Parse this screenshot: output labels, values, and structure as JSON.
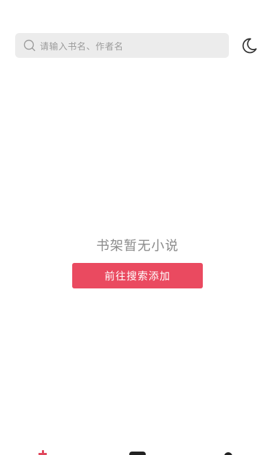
{
  "search": {
    "placeholder": "请输入书名、作者名"
  },
  "header": {
    "theme_toggle_icon": "moon-icon"
  },
  "empty_state": {
    "message": "书架暂无小说",
    "action_label": "前往搜索添加"
  },
  "colors": {
    "accent": "#ea4a60",
    "search_bg": "#ececec",
    "placeholder_text": "#9a9a9a",
    "empty_text": "#8a8a8a"
  },
  "bottom_nav": {
    "items": [
      {
        "icon": "bookshelf-icon",
        "active": true
      },
      {
        "icon": "discover-icon",
        "active": false
      },
      {
        "icon": "profile-icon",
        "active": false
      }
    ]
  }
}
